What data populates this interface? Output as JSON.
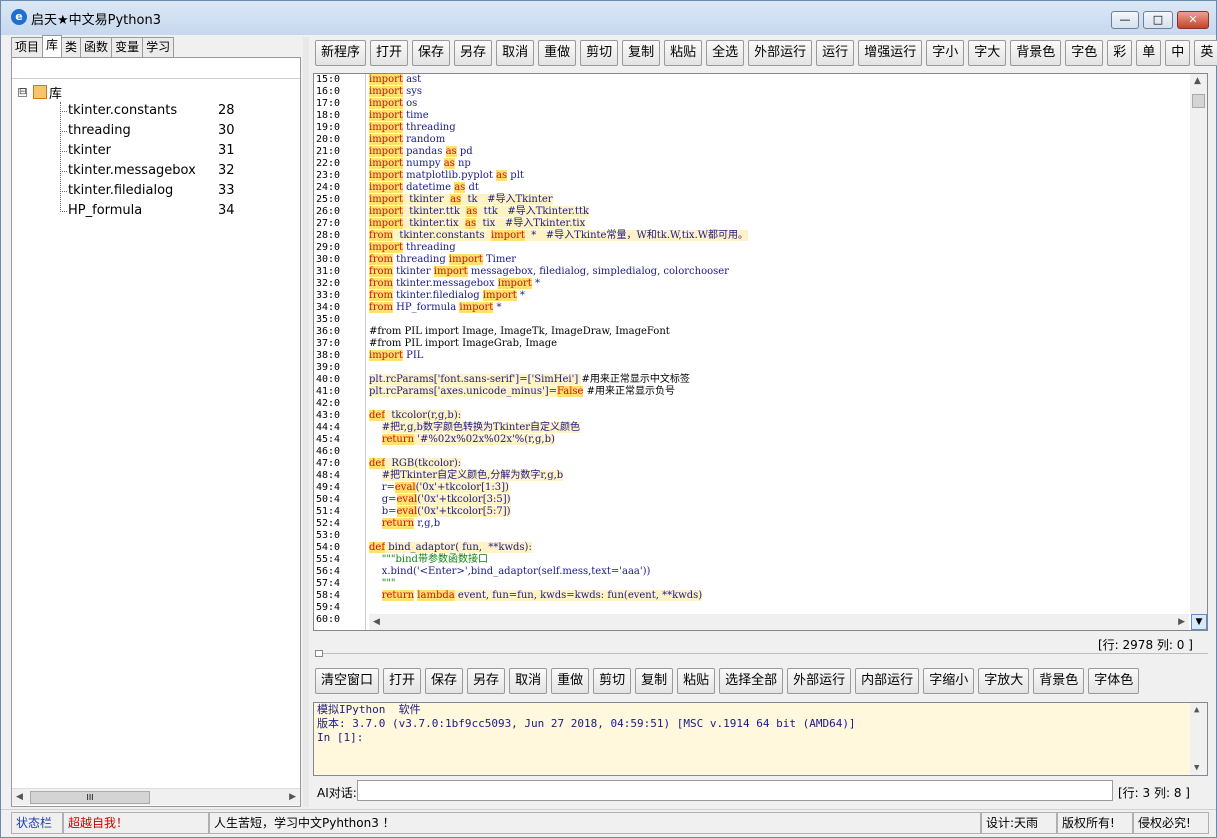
{
  "window": {
    "title": "启天★中文易Python3",
    "icon_name": "app-logo-icon",
    "icon_glyph": "e",
    "controls": {
      "minimize": "—",
      "maximize": "□",
      "close": "✕"
    }
  },
  "left": {
    "tabs": [
      "项目",
      "库",
      "类",
      "函数",
      "变量",
      "学习"
    ],
    "active_tab": "库",
    "tree": {
      "root_expander": "⊟",
      "root_label": "库",
      "items": [
        {
          "name": "tkinter.constants",
          "line": "28"
        },
        {
          "name": "threading",
          "line": "30"
        },
        {
          "name": "tkinter",
          "line": "31"
        },
        {
          "name": "tkinter.messagebox",
          "line": "32"
        },
        {
          "name": "tkinter.filedialog",
          "line": "33"
        },
        {
          "name": "HP_formula",
          "line": "34"
        }
      ]
    },
    "hscroll_grip": "III"
  },
  "toolbar": [
    "新程序",
    "打开",
    "保存",
    "另存",
    "取消",
    "重做",
    "剪切",
    "复制",
    "粘贴",
    "全选",
    "外部运行",
    "运行",
    "增强运行",
    "字小",
    "字大",
    "背景色",
    "字色",
    "彩",
    "单",
    "中",
    "英"
  ],
  "editor": {
    "line_numbers": [
      "15:0",
      "16:0",
      "17:0",
      "18:0",
      "19:0",
      "20:0",
      "21:0",
      "22:0",
      "23:0",
      "24:0",
      "25:0",
      "26:0",
      "27:0",
      "28:0",
      "29:0",
      "30:0",
      "31:0",
      "32:0",
      "33:0",
      "34:0",
      "35:0",
      "36:0",
      "37:0",
      "38:0",
      "39:0",
      "40:0",
      "41:0",
      "42:0",
      "43:0",
      "44:4",
      "45:4",
      "46:0",
      "47:0",
      "48:4",
      "49:4",
      "50:4",
      "51:4",
      "52:4",
      "53:0",
      "54:0",
      "55:4",
      "56:4",
      "57:4",
      "58:4",
      "59:4",
      "60:0"
    ],
    "lines": [
      [
        {
          "t": "import",
          "c": "kw"
        },
        {
          "t": " ast"
        }
      ],
      [
        {
          "t": "import",
          "c": "kw"
        },
        {
          "t": " sys"
        }
      ],
      [
        {
          "t": "import",
          "c": "kw"
        },
        {
          "t": " os"
        }
      ],
      [
        {
          "t": "import",
          "c": "kw"
        },
        {
          "t": " time"
        }
      ],
      [
        {
          "t": "import",
          "c": "kw"
        },
        {
          "t": " threading"
        }
      ],
      [
        {
          "t": "import",
          "c": "kw"
        },
        {
          "t": " random"
        }
      ],
      [
        {
          "t": "import",
          "c": "kw"
        },
        {
          "t": " pandas "
        },
        {
          "t": "as",
          "c": "kw"
        },
        {
          "t": " pd"
        }
      ],
      [
        {
          "t": "import",
          "c": "kw"
        },
        {
          "t": " numpy "
        },
        {
          "t": "as",
          "c": "kw"
        },
        {
          "t": " np"
        }
      ],
      [
        {
          "t": "import",
          "c": "kw"
        },
        {
          "t": " matplotlib.pyplot "
        },
        {
          "t": "as",
          "c": "kw"
        },
        {
          "t": " plt"
        }
      ],
      [
        {
          "t": "import",
          "c": "kw"
        },
        {
          "t": " datetime "
        },
        {
          "t": "as",
          "c": "kw"
        },
        {
          "t": " dt"
        }
      ],
      [
        {
          "t": "import",
          "c": "kw"
        },
        {
          "t": "  tkinter  ",
          "c": "ol"
        },
        {
          "t": "as",
          "c": "kw"
        },
        {
          "t": "  tk   #导入Tkinter",
          "c": "ol"
        }
      ],
      [
        {
          "t": "import",
          "c": "kw"
        },
        {
          "t": "  tkinter.ttk  ",
          "c": "ol"
        },
        {
          "t": "as",
          "c": "kw"
        },
        {
          "t": "  ttk   #导入Tkinter.ttk",
          "c": "ol"
        }
      ],
      [
        {
          "t": "import",
          "c": "kw"
        },
        {
          "t": "  tkinter.tix  ",
          "c": "ol"
        },
        {
          "t": "as",
          "c": "kw"
        },
        {
          "t": "  tix   #导入Tkinter.tix",
          "c": "ol"
        }
      ],
      [
        {
          "t": "from",
          "c": "kw"
        },
        {
          "t": "  tkinter.constants  ",
          "c": "ol"
        },
        {
          "t": "import",
          "c": "kw"
        },
        {
          "t": "  *   #导入Tkinte常量，W和tk.W,tix.W都可用。",
          "c": "ol"
        }
      ],
      [
        {
          "t": "import",
          "c": "kw"
        },
        {
          "t": " threading"
        }
      ],
      [
        {
          "t": "from",
          "c": "kw"
        },
        {
          "t": " threading "
        },
        {
          "t": "import",
          "c": "kw"
        },
        {
          "t": " Timer"
        }
      ],
      [
        {
          "t": "from",
          "c": "kw"
        },
        {
          "t": " tkinter "
        },
        {
          "t": "import",
          "c": "kw"
        },
        {
          "t": " messagebox, filedialog, simpledialog, colorchooser"
        }
      ],
      [
        {
          "t": "from",
          "c": "kw"
        },
        {
          "t": " tkinter.messagebox "
        },
        {
          "t": "import",
          "c": "kw"
        },
        {
          "t": " *"
        }
      ],
      [
        {
          "t": "from",
          "c": "kw"
        },
        {
          "t": " tkinter.filedialog "
        },
        {
          "t": "import",
          "c": "kw"
        },
        {
          "t": " *"
        }
      ],
      [
        {
          "t": "from",
          "c": "kw"
        },
        {
          "t": " HP_formula "
        },
        {
          "t": "import",
          "c": "kw"
        },
        {
          "t": " *"
        }
      ],
      [],
      [
        {
          "t": "#from PIL import Image, ImageTk, ImageDraw, ImageFont",
          "c": "cm"
        }
      ],
      [
        {
          "t": "#from PIL import ImageGrab, Image",
          "c": "cm"
        }
      ],
      [
        {
          "t": "import",
          "c": "kw"
        },
        {
          "t": " PIL"
        }
      ],
      [],
      [
        {
          "t": "plt.rcParams['font.sans-serif']=['SimHei'] ",
          "c": "ol"
        },
        {
          "t": "#用来正常显示中文标签",
          "c": "cm"
        }
      ],
      [
        {
          "t": "plt.rcParams['axes.unicode_minus']=",
          "c": "ol"
        },
        {
          "t": "False",
          "c": "kw"
        },
        {
          "t": " #用来正常显示负号",
          "c": "cm"
        }
      ],
      [],
      [
        {
          "t": "def",
          "c": "kw"
        },
        {
          "t": "  tkcolor(r,g,b):",
          "c": "ol"
        }
      ],
      [
        {
          "t": "    "
        },
        {
          "t": "#把r,g,b数字颜色转换为Tkinter自定义颜色",
          "c": "ol"
        }
      ],
      [
        {
          "t": "    "
        },
        {
          "t": "return",
          "c": "kw"
        },
        {
          "t": " '#%02x%02x%02x'%(r,g,b)",
          "c": "ol"
        }
      ],
      [],
      [
        {
          "t": "def",
          "c": "kw"
        },
        {
          "t": "  RGB(tkcolor):",
          "c": "ol"
        }
      ],
      [
        {
          "t": "    "
        },
        {
          "t": "#把Tkinter自定义颜色,分解为数字r,g,b",
          "c": "ol"
        }
      ],
      [
        {
          "t": "    r="
        },
        {
          "t": "eval",
          "c": "kw"
        },
        {
          "t": "('0x'+tkcolor[1:3])",
          "c": "ol"
        }
      ],
      [
        {
          "t": "    g="
        },
        {
          "t": "eval",
          "c": "kw"
        },
        {
          "t": "('0x'+tkcolor[3:5])",
          "c": "ol"
        }
      ],
      [
        {
          "t": "    b="
        },
        {
          "t": "eval",
          "c": "kw"
        },
        {
          "t": "('0x'+tkcolor[5:7])",
          "c": "ol"
        }
      ],
      [
        {
          "t": "    "
        },
        {
          "t": "return",
          "c": "kw"
        },
        {
          "t": " r,g,b"
        }
      ],
      [],
      [
        {
          "t": "def",
          "c": "kw"
        },
        {
          "t": " bind_adaptor",
          "c": "ol"
        },
        {
          "t": "( fun,  **kwds):",
          "c": "ol"
        }
      ],
      [
        {
          "t": "    \"\"\"bind带参数函数接口",
          "c": "str"
        }
      ],
      [
        {
          "t": "    x.bind('<Enter>',bind_adaptor(self.mess,text='aaa'))"
        }
      ],
      [
        {
          "t": "    \"\"\"",
          "c": "str"
        }
      ],
      [
        {
          "t": "    "
        },
        {
          "t": "return",
          "c": "kw"
        },
        {
          "t": " "
        },
        {
          "t": "lambda",
          "c": "kw"
        },
        {
          "t": " event, fun=fun, kwds=kwds: fun(event, **kwds)",
          "c": "ol"
        }
      ],
      [],
      []
    ],
    "position": "[行: 2978   列: 0 ]"
  },
  "console_toolbar": [
    "清空窗口",
    "打开",
    "保存",
    "另存",
    "取消",
    "重做",
    "剪切",
    "复制",
    "粘贴",
    "选择全部",
    "外部运行",
    "内部运行",
    "字缩小",
    "字放大",
    "背景色",
    "字体色"
  ],
  "console": {
    "lines": [
      "模拟IPython  软件",
      "版本: 3.7.0 (v3.7.0:1bf9cc5093, Jun 27 2018, 04:59:51) [MSC v.1914 64 bit (AMD64)]",
      "In [1]:"
    ]
  },
  "ai": {
    "label": "AI对话:",
    "value": "",
    "position": "[行: 3   列: 8 ]"
  },
  "statusbar": {
    "label": "状态栏",
    "slogan": "超越自我！",
    "motto": "人生苦短，学习中文Pyhthon3 ！",
    "design": "设计:天雨",
    "copyright": "版权所有!",
    "license": "侵权必究!"
  },
  "colors": {
    "keyword_bg": "#ffe16b",
    "keyword_fg": "#d01010",
    "highlight_bg": "#fff2c6",
    "console_bg": "#fff8dc",
    "status_blue": "#1a3fb0",
    "status_red": "#d00000"
  }
}
